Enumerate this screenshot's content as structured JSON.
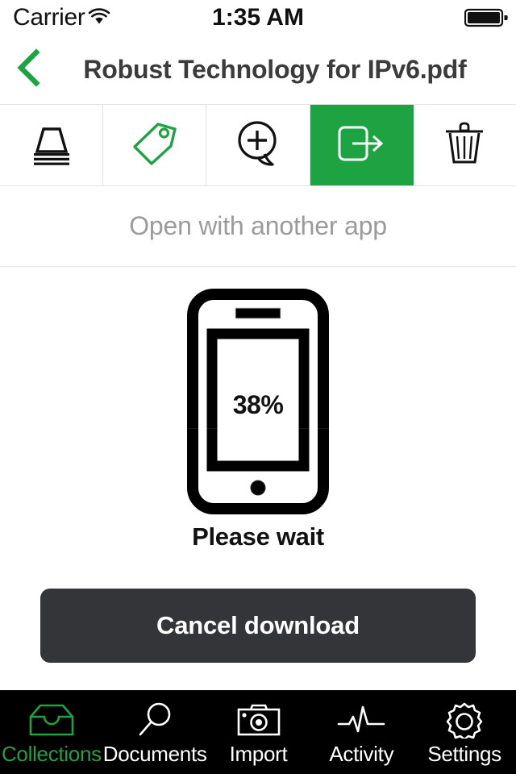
{
  "status_bar": {
    "carrier": "Carrier",
    "wifi_icon": "wifi-icon",
    "time": "1:35 AM",
    "battery_icon": "battery-full-icon"
  },
  "nav": {
    "back_icon": "chevron-left-icon",
    "title": "Robust Technology for IPv6.pdf",
    "accent_color": "#1ea342",
    "title_color": "#3b3b3b"
  },
  "toolbar": {
    "items": [
      {
        "name": "collections-stack-icon",
        "label": "Collections",
        "state": "normal",
        "color": "#111111"
      },
      {
        "name": "tag-icon",
        "label": "Tags",
        "state": "normal",
        "color": "#1ea342"
      },
      {
        "name": "add-comment-icon",
        "label": "Add comment",
        "state": "normal",
        "color": "#111111"
      },
      {
        "name": "open-in-app-icon",
        "label": "Open with another app",
        "state": "active",
        "color": "#ffffff"
      },
      {
        "name": "trash-icon",
        "label": "Delete",
        "state": "normal",
        "color": "#111111"
      }
    ],
    "active_index": 3,
    "active_bg": "#1ea342"
  },
  "subtitle": {
    "text": "Open with another app",
    "color": "#9b9b9b"
  },
  "download": {
    "percent_label": "38%",
    "percent_value": 38,
    "status_text": "Please wait",
    "cancel_label": "Cancel download",
    "cancel_bg": "#333538",
    "track_color": "#c9cacc",
    "fill_color": "#2b2d30"
  },
  "tabbar": {
    "background": "#000000",
    "active_color": "#1ea342",
    "inactive_color": "#ffffff",
    "items": [
      {
        "label": "Collections",
        "icon": "collections-tray-icon",
        "active": true
      },
      {
        "label": "Documents",
        "icon": "magnifier-icon",
        "active": false
      },
      {
        "label": "Import",
        "icon": "camera-icon",
        "active": false
      },
      {
        "label": "Activity",
        "icon": "pulse-icon",
        "active": false
      },
      {
        "label": "Settings",
        "icon": "gear-icon",
        "active": false
      }
    ]
  }
}
